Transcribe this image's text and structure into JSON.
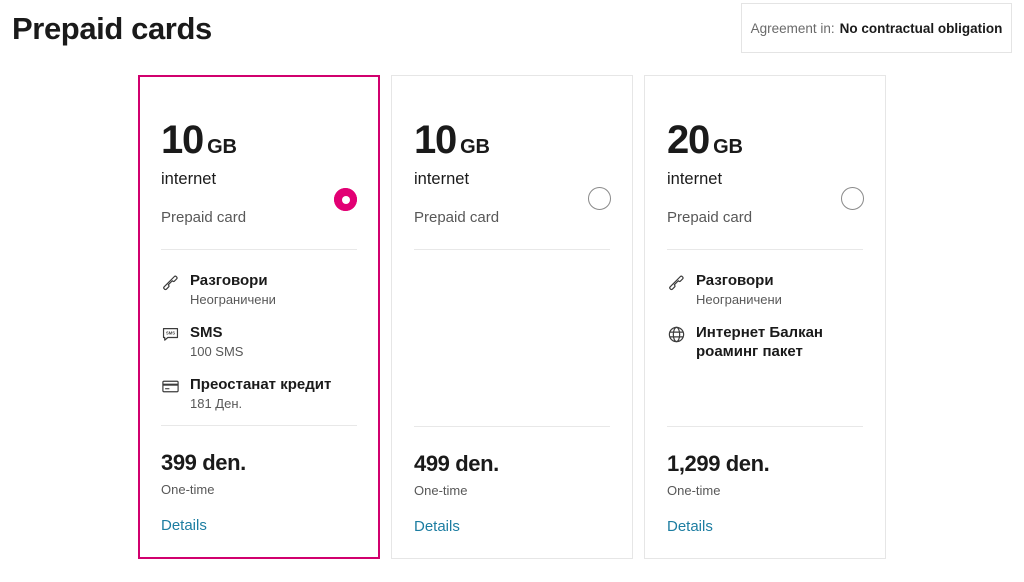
{
  "header": {
    "title": "Prepaid cards",
    "agreement_label": "Agreement in:",
    "agreement_value": "No contractual obligation"
  },
  "colors": {
    "magenta": "#e20074",
    "selected_border": "#d1006e",
    "link": "#1c7da1",
    "card_border": "#e6e6e6",
    "divider": "#e8e8e8",
    "muted_text": "#585858"
  },
  "cards": [
    {
      "id": "card-10gb-399",
      "selected": true,
      "radio_state": "selected",
      "amount": "10",
      "unit": "GB",
      "sub": "internet",
      "type": "Prepaid card",
      "features": [
        {
          "icon": "phone-icon",
          "title": "Разговори",
          "desc": "Неограничени"
        },
        {
          "icon": "sms-icon",
          "title": "SMS",
          "desc": "100 SMS"
        },
        {
          "icon": "credit-card-icon",
          "title": "Преостанат кредит",
          "desc": "181 Ден."
        }
      ],
      "price": "399 den.",
      "price_note": "One-time",
      "details_label": "Details"
    },
    {
      "id": "card-10gb-499",
      "selected": false,
      "radio_state": "unselected",
      "amount": "10",
      "unit": "GB",
      "sub": "internet",
      "type": "Prepaid card",
      "features": [],
      "price": "499 den.",
      "price_note": "One-time",
      "details_label": "Details"
    },
    {
      "id": "card-20gb-1299",
      "selected": false,
      "radio_state": "unselected",
      "amount": "20",
      "unit": "GB",
      "sub": "internet",
      "type": "Prepaid card",
      "features": [
        {
          "icon": "phone-icon",
          "title": "Разговори",
          "desc": "Неограничени"
        },
        {
          "icon": "globe-icon",
          "title": "Интернет Балкан роаминг пакет",
          "desc": ""
        }
      ],
      "price": "1,299 den.",
      "price_note": "One-time",
      "details_label": "Details"
    }
  ]
}
